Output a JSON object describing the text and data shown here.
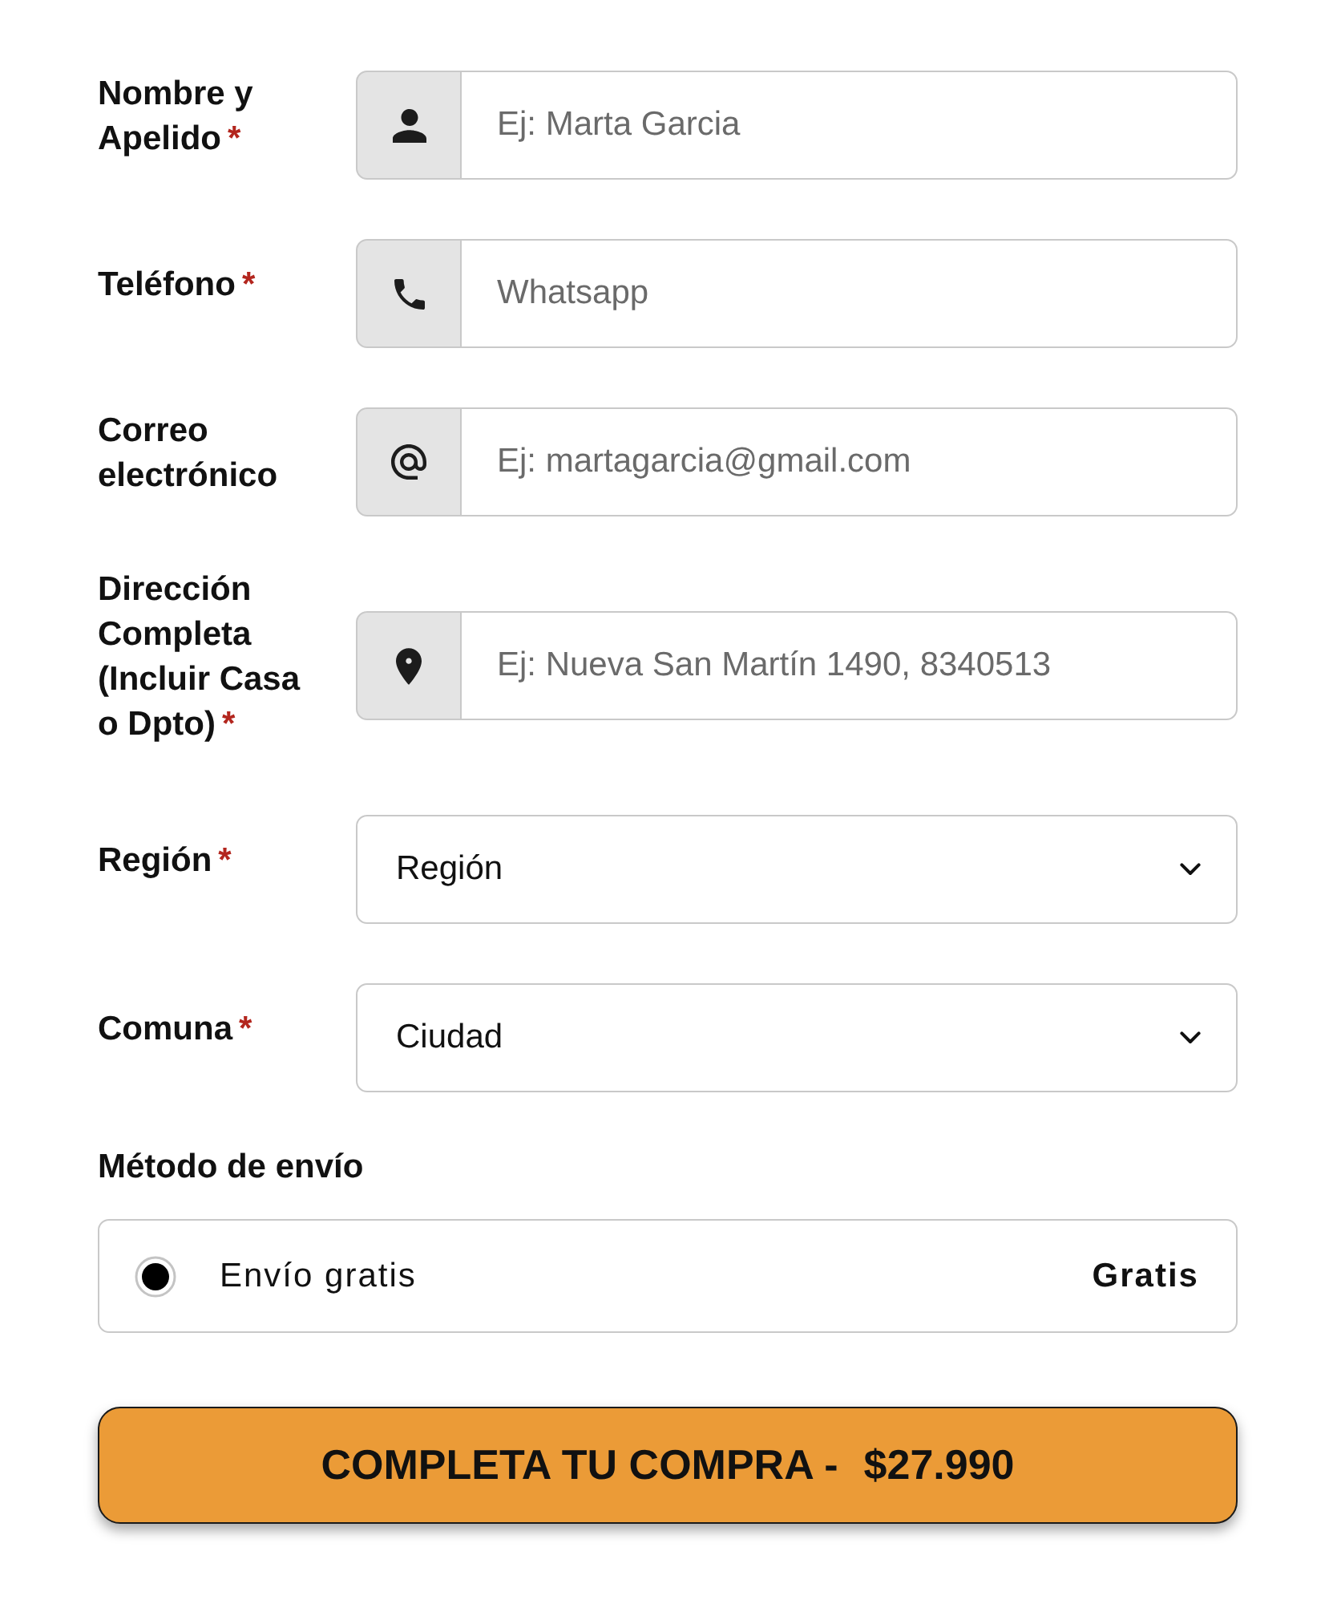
{
  "fields": [
    {
      "kind": "name",
      "label": "Nombre y Apelido",
      "required_mark": "*",
      "placeholder": "Ej: Marta Garcia"
    },
    {
      "kind": "phone",
      "label": "Teléfono",
      "required_mark": "*",
      "placeholder": "Whatsapp"
    },
    {
      "kind": "email",
      "label": "Correo electrónico",
      "placeholder": "Ej: martagarcia@gmail.com"
    },
    {
      "kind": "address",
      "label": "Dirección Completa (Incluir Casa o Dpto)",
      "required_mark": "*",
      "placeholder": "Ej: Nueva San Martín 1490, 8340513"
    },
    {
      "kind": "select",
      "label": "Región",
      "required_mark": "*",
      "value": "Región"
    },
    {
      "kind": "select",
      "label": "Comuna",
      "required_mark": "*",
      "value": "Ciudad"
    }
  ],
  "shipping": {
    "title": "Método de envío",
    "options": [
      {
        "label": "Envío gratis",
        "price": "Gratis",
        "selected": true
      }
    ]
  },
  "submit_button": {
    "label": "COMPLETA TU COMPRA -",
    "price": "$27.990"
  }
}
